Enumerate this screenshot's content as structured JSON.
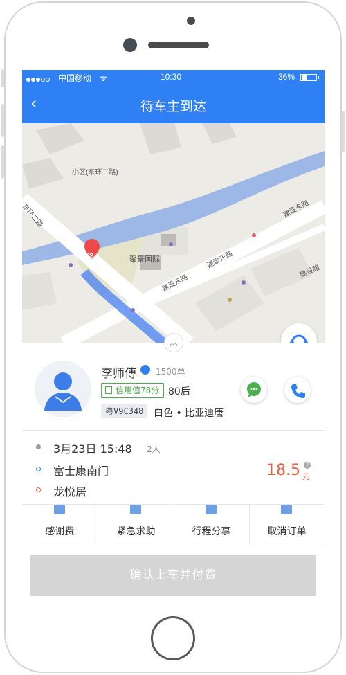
{
  "status_bar": {
    "carrier": "中国移动",
    "wifi": "ᯤ",
    "time": "10:30",
    "battery": "36%"
  },
  "nav": {
    "back": "‹",
    "title": "待车主到达"
  },
  "map": {
    "labels": [
      "小区(东环二路)",
      "东环二路",
      "聚景国际",
      "建设东路",
      "建设东路",
      "建设东路",
      "建设路"
    ],
    "marker": "终",
    "chevron": "︽"
  },
  "driver": {
    "name": "李师傅",
    "orders": "1500单",
    "credit": "信用值78分",
    "age": "80后",
    "plate": "粤V9C348",
    "car": "白色 • 比亚迪唐"
  },
  "trip": {
    "datetime": "3月23日 15:48",
    "passengers": "2人",
    "origin": "富士康南门",
    "destination": "龙悦居",
    "price": "18.5",
    "price_unit": "元"
  },
  "actions": [
    {
      "label": "感谢费"
    },
    {
      "label": "紧急求助"
    },
    {
      "label": "行程分享"
    },
    {
      "label": "取消订单"
    }
  ],
  "confirm_label": "确认上车并付费",
  "colors": {
    "primary": "#2f80f5",
    "price": "#ec5b3f",
    "credit": "#4caf50"
  }
}
